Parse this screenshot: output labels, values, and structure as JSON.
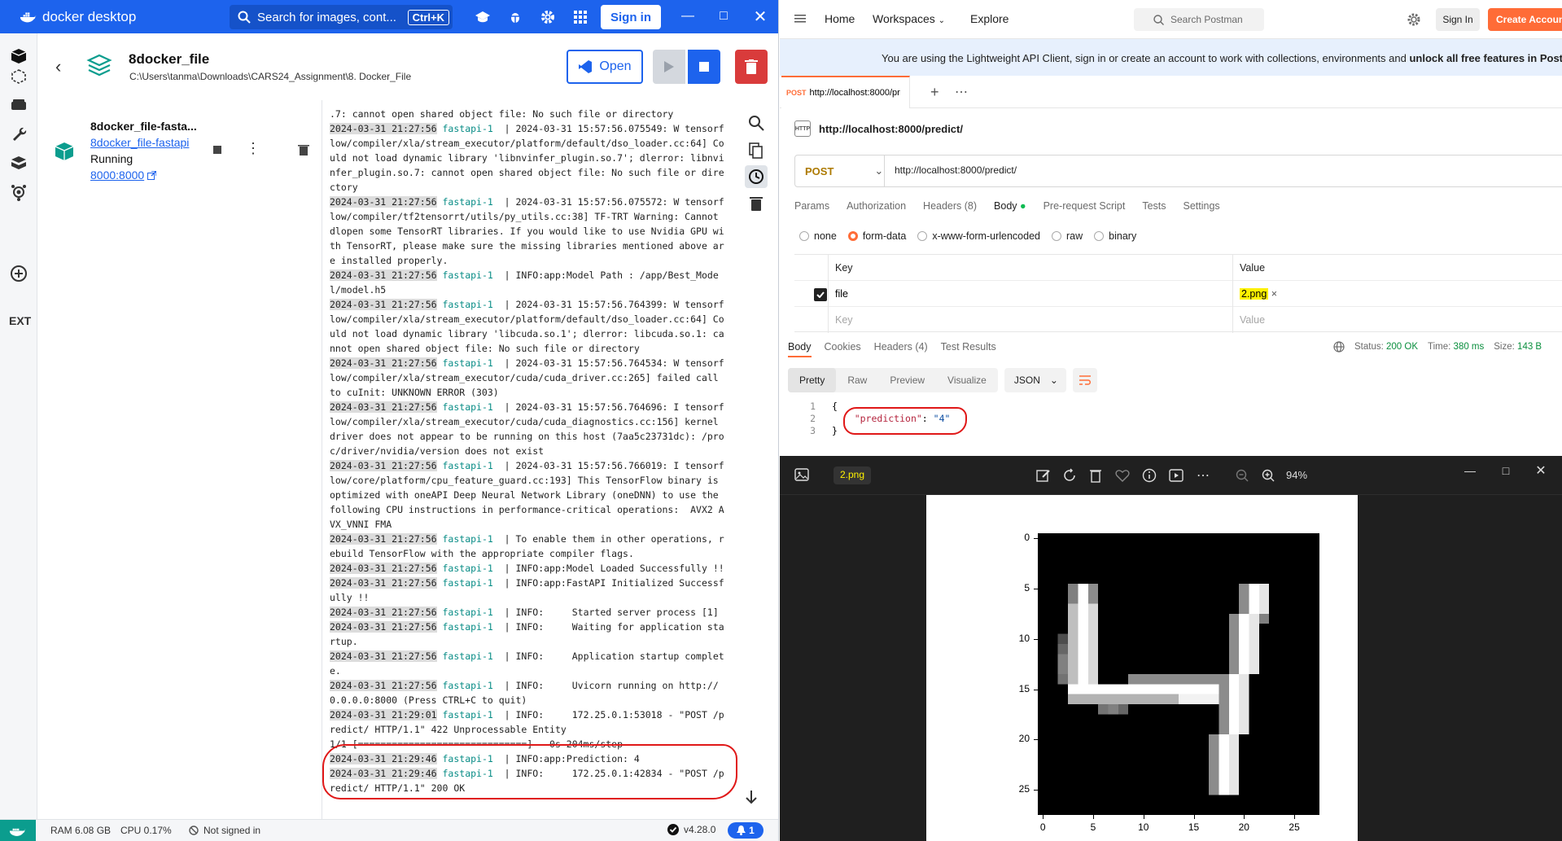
{
  "docker": {
    "app_title": "docker desktop",
    "search_placeholder": "Search for images, cont...",
    "search_shortcut": "Ctrl+K",
    "sign_in": "Sign in",
    "extensions_label": "EXT",
    "project": {
      "name": "8docker_file",
      "path": "C:\\Users\\tanma\\Downloads\\CARS24_Assignment\\8. Docker_File",
      "open_label": "Open"
    },
    "container": {
      "name": "8docker_file-fasta...",
      "link": "8docker_file-fastapi",
      "status": "Running",
      "port": "8000:8000"
    },
    "logs": [
      {
        "ts": "",
        "svc": "",
        "msg": ".7: cannot open shared object file: No such file or directory"
      },
      {
        "ts": "2024-03-31 21:27:56",
        "svc": "fastapi-1",
        "msg": "  | 2024-03-31 15:57:56.075549: W tensorflow/compiler/xla/stream_executor/platform/default/dso_loader.cc:64] Could not load dynamic library 'libnvinfer_plugin.so.7'; dlerror: libnvinfer_plugin.so.7: cannot open shared object file: No such file or directory"
      },
      {
        "ts": "2024-03-31 21:27:56",
        "svc": "fastapi-1",
        "msg": "  | 2024-03-31 15:57:56.075572: W tensorflow/compiler/tf2tensorrt/utils/py_utils.cc:38] TF-TRT Warning: Cannot dlopen some TensorRT libraries. If you would like to use Nvidia GPU with TensorRT, please make sure the missing libraries mentioned above are installed properly."
      },
      {
        "ts": "2024-03-31 21:27:56",
        "svc": "fastapi-1",
        "msg": "  | INFO:app:Model Path : /app/Best_Model/model.h5"
      },
      {
        "ts": "2024-03-31 21:27:56",
        "svc": "fastapi-1",
        "msg": "  | 2024-03-31 15:57:56.764399: W tensorflow/compiler/xla/stream_executor/platform/default/dso_loader.cc:64] Could not load dynamic library 'libcuda.so.1'; dlerror: libcuda.so.1: cannot open shared object file: No such file or directory"
      },
      {
        "ts": "2024-03-31 21:27:56",
        "svc": "fastapi-1",
        "msg": "  | 2024-03-31 15:57:56.764534: W tensorflow/compiler/xla/stream_executor/cuda/cuda_driver.cc:265] failed call to cuInit: UNKNOWN ERROR (303)"
      },
      {
        "ts": "2024-03-31 21:27:56",
        "svc": "fastapi-1",
        "msg": "  | 2024-03-31 15:57:56.764696: I tensorflow/compiler/xla/stream_executor/cuda/cuda_diagnostics.cc:156] kernel driver does not appear to be running on this host (7aa5c23731dc): /proc/driver/nvidia/version does not exist"
      },
      {
        "ts": "2024-03-31 21:27:56",
        "svc": "fastapi-1",
        "msg": "  | 2024-03-31 15:57:56.766019: I tensorflow/core/platform/cpu_feature_guard.cc:193] This TensorFlow binary is optimized with oneAPI Deep Neural Network Library (oneDNN) to use the following CPU instructions in performance-critical operations:  AVX2 AVX_VNNI FMA"
      },
      {
        "ts": "2024-03-31 21:27:56",
        "svc": "fastapi-1",
        "msg": "  | To enable them in other operations, rebuild TensorFlow with the appropriate compiler flags."
      },
      {
        "ts": "2024-03-31 21:27:56",
        "svc": "fastapi-1",
        "msg": "  | INFO:app:Model Loaded Successfully !!"
      },
      {
        "ts": "2024-03-31 21:27:56",
        "svc": "fastapi-1",
        "msg": "  | INFO:app:FastAPI Initialized Successfully !!"
      },
      {
        "ts": "2024-03-31 21:27:56",
        "svc": "fastapi-1",
        "msg": "  | INFO:     Started server process [1]"
      },
      {
        "ts": "2024-03-31 21:27:56",
        "svc": "fastapi-1",
        "msg": "  | INFO:     Waiting for application startup."
      },
      {
        "ts": "2024-03-31 21:27:56",
        "svc": "fastapi-1",
        "msg": "  | INFO:     Application startup complete."
      },
      {
        "ts": "2024-03-31 21:27:56",
        "svc": "fastapi-1",
        "msg": "  | INFO:     Uvicorn running on http://0.0.0.0:8000 (Press CTRL+C to quit)"
      },
      {
        "ts": "2024-03-31 21:29:01",
        "svc": "fastapi-1",
        "msg": "  | INFO:     172.25.0.1:53018 - \"POST /predict/ HTTP/1.1\" 422 Unprocessable Entity"
      },
      {
        "ts": "",
        "svc": "",
        "msg": "1/1 [==============================] - 0s 204ms/step"
      },
      {
        "ts": "2024-03-31 21:29:46",
        "svc": "fastapi-1",
        "msg": "  | INFO:app:Prediction: 4"
      },
      {
        "ts": "2024-03-31 21:29:46",
        "svc": "fastapi-1",
        "msg": "  | INFO:     172.25.0.1:42834 - \"POST /predict/ HTTP/1.1\" 200 OK"
      }
    ],
    "status": {
      "ram": "RAM 6.08 GB",
      "cpu": "CPU 0.17%",
      "signed": "Not signed in",
      "version": "v4.28.0",
      "notifications": "1"
    }
  },
  "postman": {
    "nav": [
      "Home",
      "Workspaces",
      "Explore"
    ],
    "search_placeholder": "Search Postman",
    "sign_in": "Sign In",
    "create_account": "Create Account",
    "banner_text": "You are using the Lightweight API Client, sign in or create an account to work with collections, environments and ",
    "banner_bold": "unlock all free features in Postman",
    "tab": {
      "method": "POST",
      "url": "http://localhost:8000/pr"
    },
    "request_title": "http://localhost:8000/predict/",
    "method": "POST",
    "url": "http://localhost:8000/predict/",
    "request_tabs": [
      "Params",
      "Authorization",
      "Headers (8)",
      "Body",
      "Pre-request Script",
      "Tests",
      "Settings"
    ],
    "body_types": [
      "none",
      "form-data",
      "x-www-form-urlencoded",
      "raw",
      "binary"
    ],
    "kv_header": {
      "key": "Key",
      "value": "Value"
    },
    "kv_rows": [
      {
        "key": "file",
        "value": "2.png"
      }
    ],
    "kv_placeholder": {
      "key": "Key",
      "value": "Value"
    },
    "response_tabs": [
      "Body",
      "Cookies",
      "Headers (4)",
      "Test Results"
    ],
    "response_status": {
      "status_label": "Status:",
      "status": "200 OK",
      "time_label": "Time:",
      "time": "380 ms",
      "size_label": "Size:",
      "size": "143 B"
    },
    "views": [
      "Pretty",
      "Raw",
      "Preview",
      "Visualize"
    ],
    "format": "JSON",
    "code": {
      "lines": [
        "1",
        "2",
        "3"
      ],
      "open": "{",
      "key": "\"prediction\"",
      "sep": ": ",
      "value": "\"4\"",
      "close": "}"
    }
  },
  "photos": {
    "filename": "2.png",
    "zoom": "94%",
    "yticks": [
      "0",
      "5",
      "10",
      "15",
      "20",
      "25"
    ],
    "xticks": [
      "0",
      "5",
      "10",
      "15",
      "20",
      "25"
    ]
  },
  "colors": {
    "docker_blue": "#1d63ed",
    "postman_orange": "#ff6c37",
    "annotation_red": "#e01818",
    "highlight_yellow": "#fff200"
  }
}
